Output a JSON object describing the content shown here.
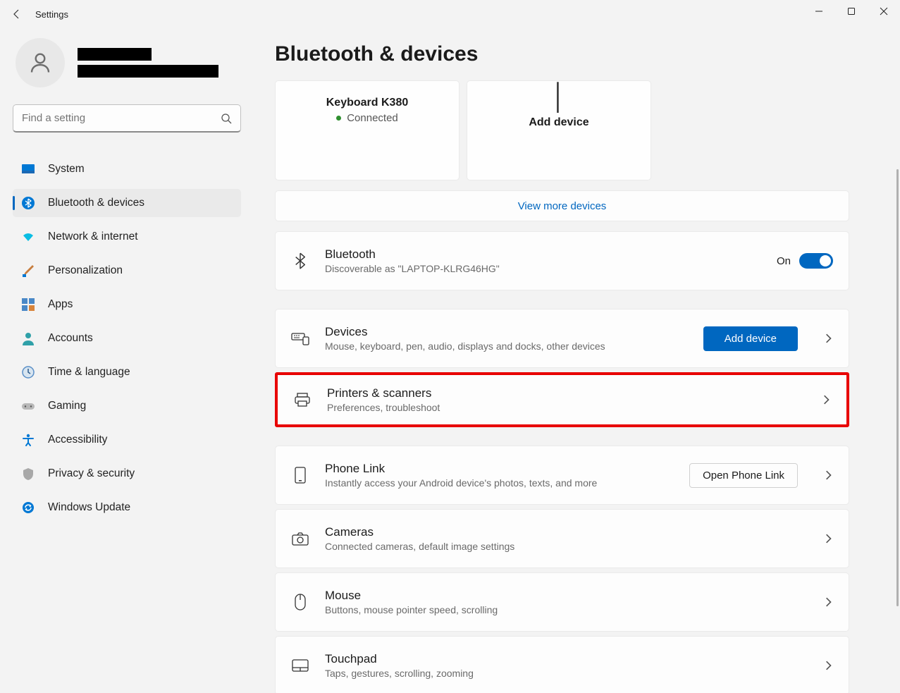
{
  "titlebar": {
    "title": "Settings"
  },
  "search": {
    "placeholder": "Find a setting"
  },
  "sidebar": {
    "items": [
      {
        "label": "System"
      },
      {
        "label": "Bluetooth & devices"
      },
      {
        "label": "Network & internet"
      },
      {
        "label": "Personalization"
      },
      {
        "label": "Apps"
      },
      {
        "label": "Accounts"
      },
      {
        "label": "Time & language"
      },
      {
        "label": "Gaming"
      },
      {
        "label": "Accessibility"
      },
      {
        "label": "Privacy & security"
      },
      {
        "label": "Windows Update"
      }
    ]
  },
  "main": {
    "heading": "Bluetooth & devices",
    "device_card": {
      "name": "Keyboard K380",
      "status": "Connected"
    },
    "add_card": {
      "label": "Add device"
    },
    "view_more": "View more devices",
    "bluetooth": {
      "title": "Bluetooth",
      "subtitle": "Discoverable as \"LAPTOP-KLRG46HG\"",
      "state": "On"
    },
    "rows": {
      "devices": {
        "title": "Devices",
        "subtitle": "Mouse, keyboard, pen, audio, displays and docks, other devices",
        "button": "Add device"
      },
      "printers": {
        "title": "Printers & scanners",
        "subtitle": "Preferences, troubleshoot"
      },
      "phone": {
        "title": "Phone Link",
        "subtitle": "Instantly access your Android device's photos, texts, and more",
        "button": "Open Phone Link"
      },
      "cameras": {
        "title": "Cameras",
        "subtitle": "Connected cameras, default image settings"
      },
      "mouse": {
        "title": "Mouse",
        "subtitle": "Buttons, mouse pointer speed, scrolling"
      },
      "touchpad": {
        "title": "Touchpad",
        "subtitle": "Taps, gestures, scrolling, zooming"
      }
    }
  }
}
